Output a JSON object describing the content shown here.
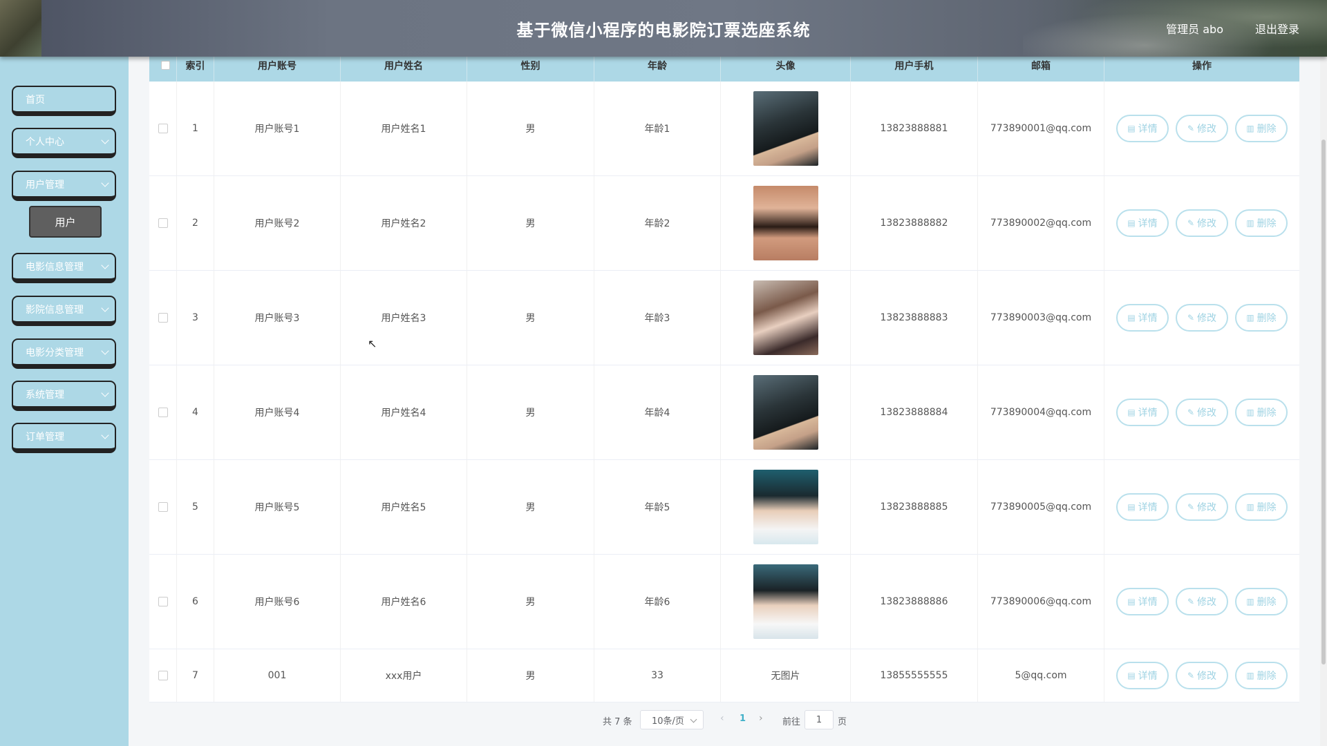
{
  "header": {
    "title": "基于微信小程序的电影院订票选座系统",
    "user": "管理员 abo",
    "logout": "退出登录"
  },
  "sidebar": {
    "items": [
      {
        "label": "首页",
        "has_chevron": false
      },
      {
        "label": "个人中心",
        "has_chevron": true
      },
      {
        "label": "用户管理",
        "has_chevron": true
      },
      {
        "label": "电影信息管理",
        "has_chevron": true
      },
      {
        "label": "影院信息管理",
        "has_chevron": true
      },
      {
        "label": "电影分类管理",
        "has_chevron": true
      },
      {
        "label": "系统管理",
        "has_chevron": true
      },
      {
        "label": "订单管理",
        "has_chevron": true
      }
    ],
    "sub_item": "用户"
  },
  "table": {
    "columns": [
      "索引",
      "用户账号",
      "用户姓名",
      "性别",
      "年龄",
      "头像",
      "用户手机",
      "邮箱",
      "操作"
    ],
    "rows": [
      {
        "index": "1",
        "account": "用户账号1",
        "name": "用户姓名1",
        "gender": "男",
        "age": "年龄1",
        "avatar": "photo",
        "phone": "13823888881",
        "email": "773890001@qq.com"
      },
      {
        "index": "2",
        "account": "用户账号2",
        "name": "用户姓名2",
        "gender": "男",
        "age": "年龄2",
        "avatar": "photo",
        "phone": "13823888882",
        "email": "773890002@qq.com"
      },
      {
        "index": "3",
        "account": "用户账号3",
        "name": "用户姓名3",
        "gender": "男",
        "age": "年龄3",
        "avatar": "photo",
        "phone": "13823888883",
        "email": "773890003@qq.com"
      },
      {
        "index": "4",
        "account": "用户账号4",
        "name": "用户姓名4",
        "gender": "男",
        "age": "年龄4",
        "avatar": "photo",
        "phone": "13823888884",
        "email": "773890004@qq.com"
      },
      {
        "index": "5",
        "account": "用户账号5",
        "name": "用户姓名5",
        "gender": "男",
        "age": "年龄5",
        "avatar": "photo",
        "phone": "13823888885",
        "email": "773890005@qq.com"
      },
      {
        "index": "6",
        "account": "用户账号6",
        "name": "用户姓名6",
        "gender": "男",
        "age": "年龄6",
        "avatar": "photo",
        "phone": "13823888886",
        "email": "773890006@qq.com"
      },
      {
        "index": "7",
        "account": "001",
        "name": "xxx用户",
        "gender": "男",
        "age": "33",
        "avatar": "无图片",
        "phone": "13855555555",
        "email": "5@qq.com"
      }
    ],
    "actions": {
      "detail": "详情",
      "edit": "修改",
      "delete": "删除"
    }
  },
  "pagination": {
    "total": "共 7 条",
    "page_size": "10条/页",
    "current_page": "1",
    "goto_label": "前往",
    "goto_value": "1",
    "page_suffix": "页"
  },
  "colors": {
    "accent": "#add8e6",
    "header_bg": "#6c7482",
    "action_text": "#9fd3e3"
  }
}
